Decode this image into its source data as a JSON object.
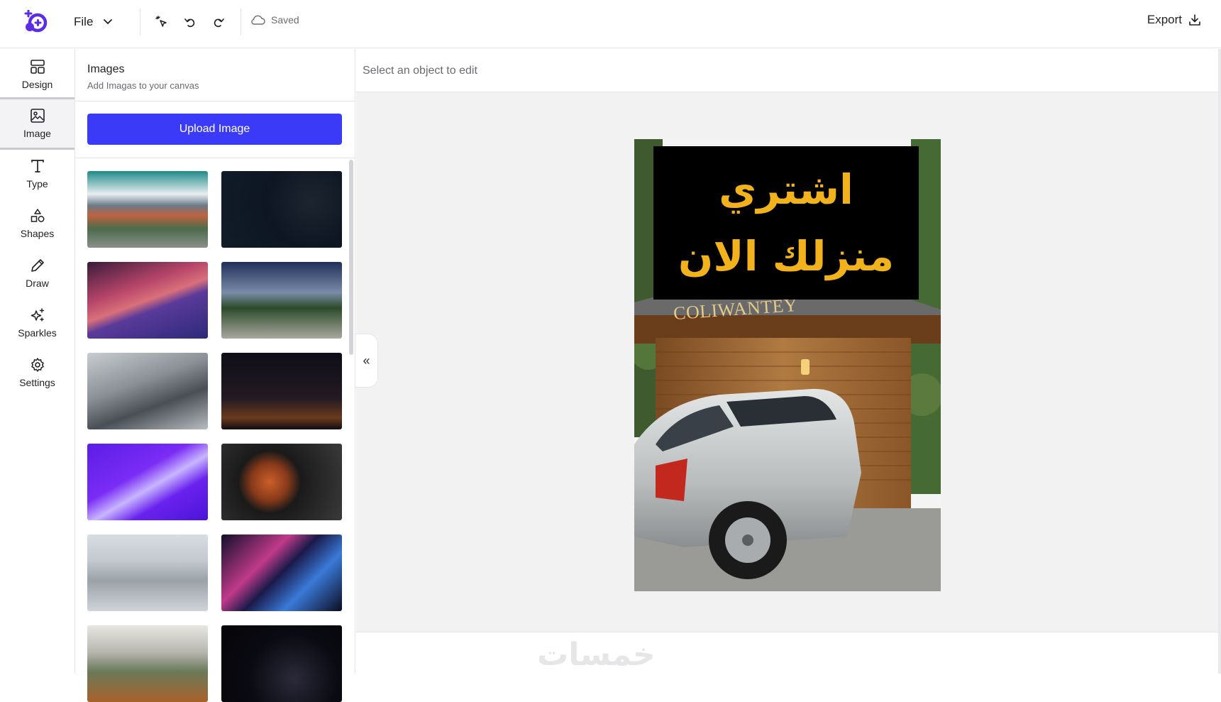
{
  "header": {
    "file_label": "File",
    "saved_label": "Saved",
    "export_label": "Export"
  },
  "nav": {
    "items": [
      {
        "label": "Design",
        "icon": "layout-icon"
      },
      {
        "label": "Image",
        "icon": "image-icon",
        "active": true
      },
      {
        "label": "Type",
        "icon": "type-icon"
      },
      {
        "label": "Shapes",
        "icon": "shapes-icon"
      },
      {
        "label": "Draw",
        "icon": "pencil-icon"
      },
      {
        "label": "Sparkles",
        "icon": "sparkles-icon"
      },
      {
        "label": "Settings",
        "icon": "gear-icon"
      }
    ]
  },
  "panel": {
    "title": "Images",
    "subtitle": "Add Imagas to your canvas",
    "upload_label": "Upload Image",
    "collapse_glyph": "«"
  },
  "workspace": {
    "hint": "Select an object to edit",
    "watermark": "خمسات"
  },
  "canvas": {
    "headline_line1": "اشتري",
    "headline_line2": "منزلك الان",
    "sign_text": "COLIWANTEY"
  },
  "colors": {
    "accent": "#3b3bf7",
    "logo": "#5b2ee6",
    "headline_text": "#f2b21c",
    "headline_bg": "#000000"
  }
}
